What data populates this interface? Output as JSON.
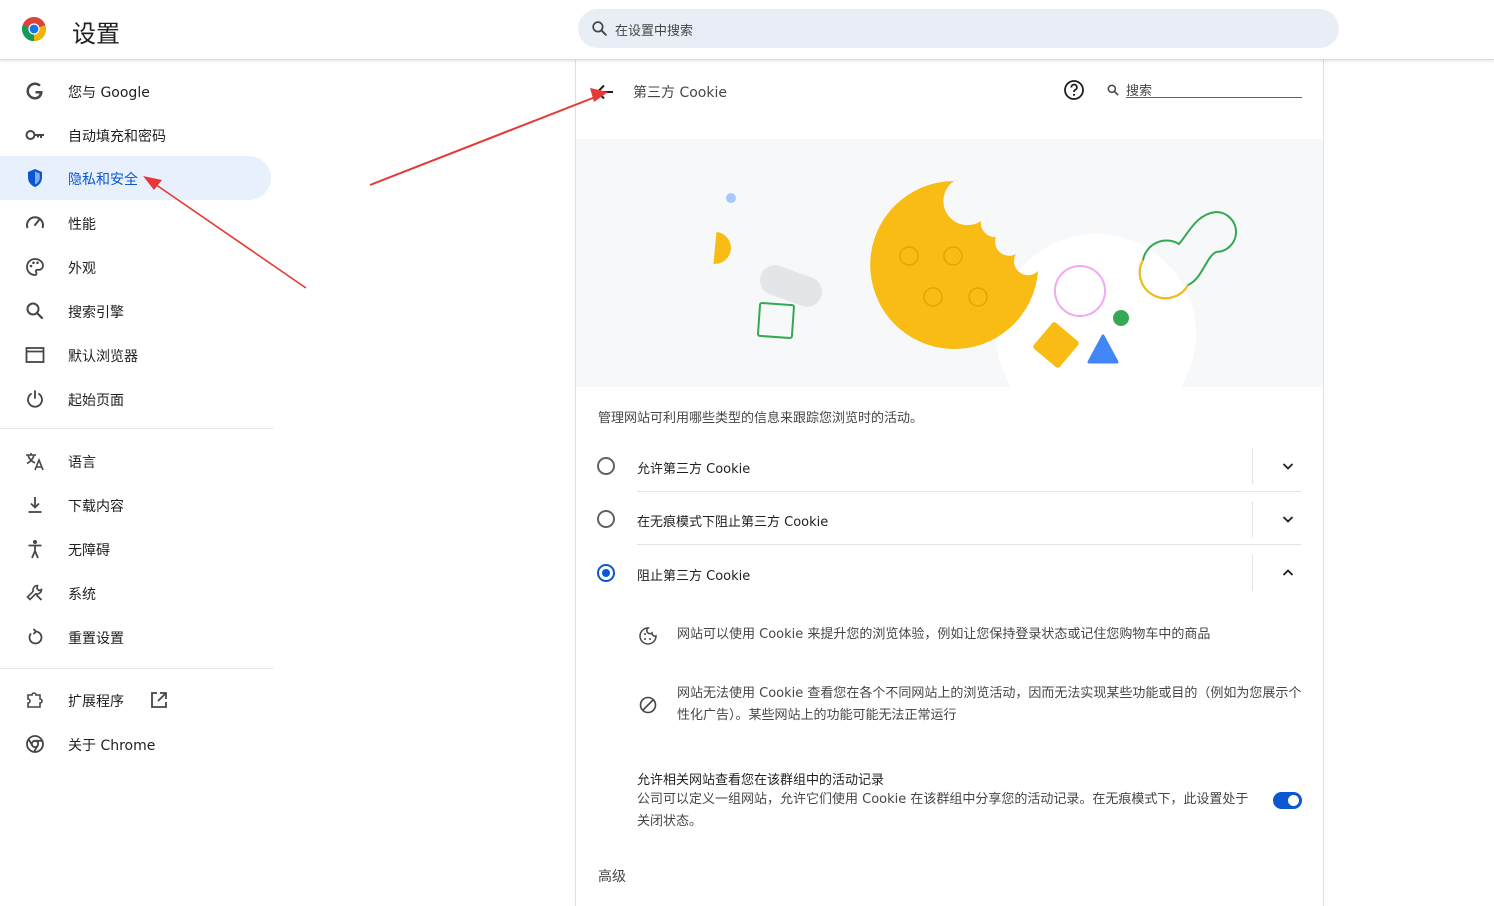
{
  "app": {
    "title": "设置"
  },
  "search": {
    "placeholder": "在设置中搜索"
  },
  "sidebar": {
    "items": [
      {
        "label": "您与 Google",
        "icon": "google-g-icon"
      },
      {
        "label": "自动填充和密码",
        "icon": "key-icon"
      },
      {
        "label": "隐私和安全",
        "icon": "shield-icon",
        "active": true
      },
      {
        "label": "性能",
        "icon": "speedometer-icon"
      },
      {
        "label": "外观",
        "icon": "palette-icon"
      },
      {
        "label": "搜索引擎",
        "icon": "search-icon"
      },
      {
        "label": "默认浏览器",
        "icon": "browser-window-icon"
      },
      {
        "label": "起始页面",
        "icon": "power-icon"
      },
      {
        "label": "语言",
        "icon": "translate-icon"
      },
      {
        "label": "下载内容",
        "icon": "download-icon"
      },
      {
        "label": "无障碍",
        "icon": "accessibility-icon"
      },
      {
        "label": "系统",
        "icon": "wrench-icon"
      },
      {
        "label": "重置设置",
        "icon": "reset-icon"
      },
      {
        "label": "扩展程序",
        "icon": "puzzle-icon"
      },
      {
        "label": "关于 Chrome",
        "icon": "chrome-icon"
      }
    ]
  },
  "page": {
    "title": "第三方 Cookie",
    "search_placeholder": "搜索",
    "description": "管理网站可利用哪些类型的信息来跟踪您浏览时的活动。",
    "options": [
      {
        "label": "允许第三方 Cookie",
        "selected": false,
        "expanded": false
      },
      {
        "label": "在无痕模式下阻止第三方 Cookie",
        "selected": false,
        "expanded": false
      },
      {
        "label": "阻止第三方 Cookie",
        "selected": true,
        "expanded": true
      }
    ],
    "details": [
      {
        "icon": "cookie-icon",
        "text": "网站可以使用 Cookie 来提升您的浏览体验，例如让您保持登录状态或记住您购物车中的商品"
      },
      {
        "icon": "block-icon",
        "text": "网站无法使用 Cookie 查看您在各个不同网站上的浏览活动，因而无法实现某些功能或目的（例如为您展示个性化广告）。某些网站上的功能可能无法正常运行"
      }
    ],
    "related_sites": {
      "title": "允许相关网站查看您在该群组中的活动记录",
      "description": "公司可以定义一组网站，允许它们使用 Cookie 在该群组中分享您的活动记录。在无痕模式下，此设置处于关闭状态。",
      "enabled": true
    },
    "advanced_label": "高级"
  },
  "colors": {
    "accent": "#0b57d0",
    "annotation": "#e53935",
    "active_bg": "#e8f0fe"
  }
}
